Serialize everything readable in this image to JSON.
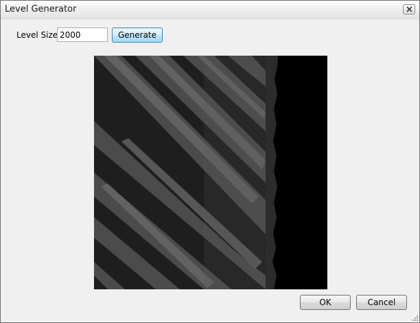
{
  "window": {
    "title": "Level Generator"
  },
  "form": {
    "level_size_label": "Level Size",
    "level_size_value": "2000",
    "generate_label": "Generate"
  },
  "footer": {
    "ok_label": "OK",
    "cancel_label": "Cancel"
  },
  "icons": {
    "close": "close-icon",
    "resize": "resize-grip-icon"
  },
  "colors": {
    "dialog_background": "#f0f0f0",
    "preview_dark": "#1e1e1e",
    "preview_edge": "#000000",
    "stripe_mid": "#4b4b4b",
    "stripe_light": "#6a6a6a"
  }
}
